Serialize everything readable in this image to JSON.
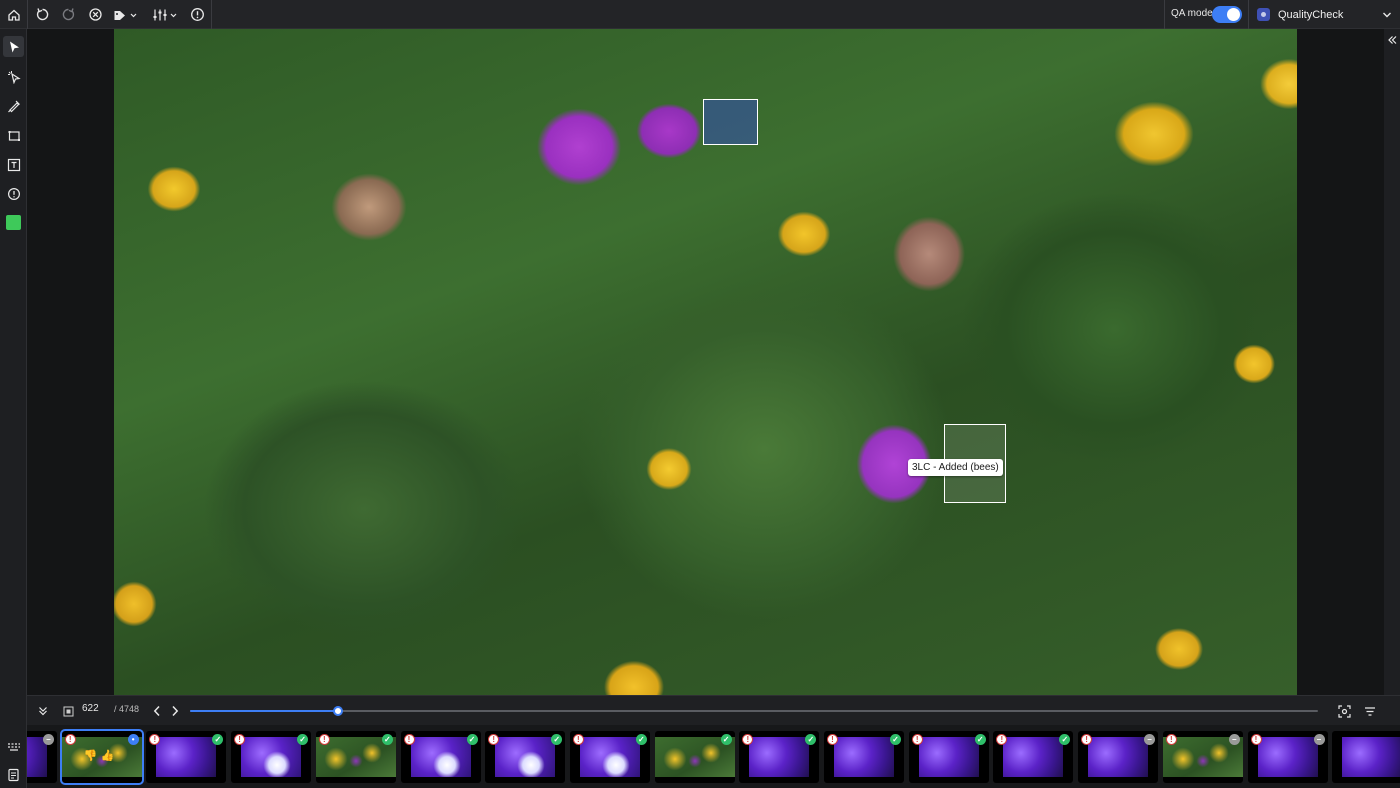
{
  "topbar": {
    "qa_mode_label": "QA mode",
    "qa_mode_on": true,
    "dataset_select": "QualityCheck"
  },
  "canvas": {
    "annotation_label": "3LC - Added (bees)"
  },
  "controls": {
    "frame_current": "622",
    "frame_total": "/ 4748",
    "progress_fraction": 0.131
  },
  "filmstrip": {
    "thumbnails": [
      {
        "kind": "purple",
        "warn": false,
        "status": "neutral"
      },
      {
        "kind": "field",
        "warn": true,
        "status": "info",
        "selected": true
      },
      {
        "kind": "purple",
        "warn": true,
        "status": "ok"
      },
      {
        "kind": "purple-white",
        "warn": true,
        "status": "ok"
      },
      {
        "kind": "field",
        "warn": true,
        "status": "ok"
      },
      {
        "kind": "purple-white",
        "warn": true,
        "status": "ok"
      },
      {
        "kind": "purple-white",
        "warn": true,
        "status": "ok"
      },
      {
        "kind": "purple-white",
        "warn": true,
        "status": "ok"
      },
      {
        "kind": "field",
        "warn": false,
        "status": "ok"
      },
      {
        "kind": "purple",
        "warn": true,
        "status": "ok"
      },
      {
        "kind": "purple",
        "warn": true,
        "status": "ok"
      },
      {
        "kind": "purple",
        "warn": true,
        "status": "ok"
      },
      {
        "kind": "purple",
        "warn": true,
        "status": "ok"
      },
      {
        "kind": "purple",
        "warn": true,
        "status": "neutral"
      },
      {
        "kind": "field",
        "warn": true,
        "status": "neutral"
      },
      {
        "kind": "purple",
        "warn": true,
        "status": "neutral"
      },
      {
        "kind": "purple",
        "warn": false,
        "status": "none"
      }
    ]
  },
  "colors": {
    "accent": "#3d7ef5",
    "annotation_tool_color": "#3ec95a",
    "ok": "#2fbf6a",
    "warn": "#d23c3c"
  }
}
